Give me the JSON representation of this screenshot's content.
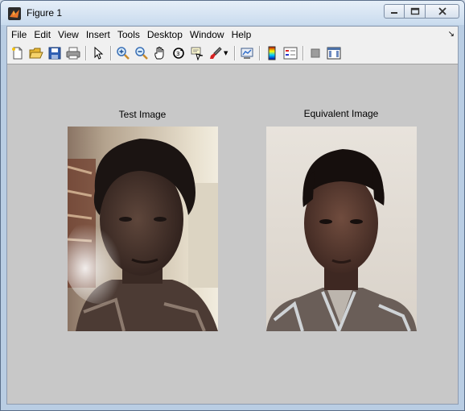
{
  "window": {
    "title": "Figure 1",
    "minimize_glyph": "▭",
    "maximize_glyph": "▢",
    "close_glyph": "✕"
  },
  "menubar": {
    "items": [
      "File",
      "Edit",
      "View",
      "Insert",
      "Tools",
      "Desktop",
      "Window",
      "Help"
    ],
    "dock_glyph": "↘"
  },
  "toolbar": {
    "buttons": [
      "new-figure-icon",
      "open-file-icon",
      "save-icon",
      "print-icon",
      "edit-plot-arrow-icon",
      "zoom-in-icon",
      "zoom-out-icon",
      "pan-hand-icon",
      "rotate-3d-icon",
      "data-cursor-icon",
      "brush-icon",
      "link-plot-icon",
      "insert-colorbar-icon",
      "insert-legend-icon",
      "hide-plot-tools-icon",
      "show-plot-tools-icon"
    ]
  },
  "axes": [
    {
      "title": "Test Image"
    },
    {
      "title": "Equivalent Image"
    }
  ],
  "colors": {
    "figure_bg": "#c8c8c8",
    "menu_bg": "#f0f0f0",
    "frame": "#b9cde3"
  }
}
